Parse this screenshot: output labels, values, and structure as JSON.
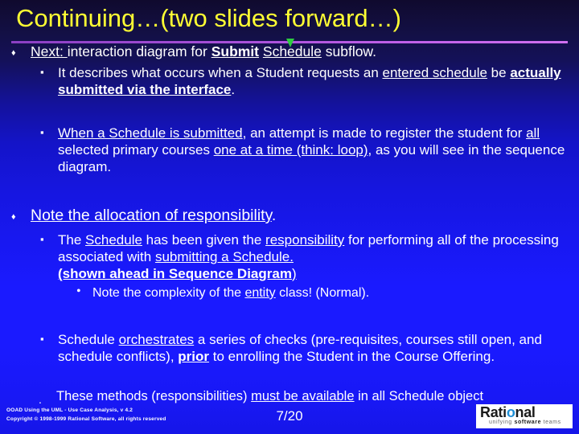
{
  "slide": {
    "title": "Continuing…(two slides forward…)",
    "page_number": "7/20",
    "title_color": "#ffff33",
    "background_top_color": "#100a2e",
    "background_bottom_color": "#1a1aff",
    "rule_color": "#b35ae0",
    "bullet_level1_glyph": "♦",
    "bullet_level2_glyph": "▪",
    "bullet_level3_glyph": "•"
  },
  "bullets": {
    "b1_next": {
      "level": 1,
      "plain": "Next:  interaction diagram for Submit Schedule subflow."
    },
    "b2_describes": {
      "level": 2,
      "plain": "It describes what occurs when a Student requests an entered schedule be actually submitted via the interface."
    },
    "b3_when_submitted": {
      "level": 2,
      "plain": "When a Schedule is submitted, an attempt is made to register the student for all selected primary courses one at a time (think: loop), as you will see in the sequence diagram."
    },
    "b4_note_allocation": {
      "level": 1,
      "plain": "Note the allocation of responsibility."
    },
    "b5_schedule_responsibility": {
      "level": 2,
      "plain": "The Schedule has been given the responsibility for performing all of the processing associated with submitting a Schedule. (shown ahead in Sequence Diagram)"
    },
    "b6_complexity": {
      "level": 3,
      "plain": "Note the complexity of the entity class!  (Normal)."
    },
    "b7_orchestrates": {
      "level": 2,
      "plain": "Schedule orchestrates a series of checks (pre-requisites, courses still open, and schedule conflicts), prior to enrolling the Student in the Course Offering."
    },
    "b8_methods": {
      "level": 2,
      "plain": "These methods (responsibilities) must be available in all Schedule object"
    }
  },
  "footer": {
    "course_line": "OOAD Using the UML - Use Case Analysis, v 4.2",
    "copyright_line": "Copyright © 1998-1999 Rational Software, all rights reserved",
    "logo_text": "Rational",
    "logo_tagline_1": "unifying",
    "logo_tagline_2": "software",
    "logo_tagline_3": "teams"
  }
}
